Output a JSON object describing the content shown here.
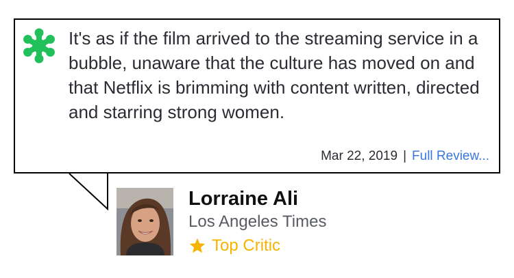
{
  "review": {
    "quote": "It's as if the film arrived to the streaming service in a bubble, unaware that the culture has moved on and that Netflix is brimming with content written, directed and starring strong women.",
    "date": "Mar 22, 2019",
    "separator": "|",
    "full_review_link": "Full Review...",
    "score_icon": "rotten-splat-icon"
  },
  "critic": {
    "name": "Lorraine Ali",
    "publication": "Los Angeles Times",
    "badge_label": "Top Critic",
    "badge_icon": "star-icon"
  },
  "colors": {
    "splat": "#22c05a",
    "link": "#3976dc",
    "badge": "#f4b400",
    "border": "#000000",
    "text": "#2a2c32",
    "muted": "#585b61"
  }
}
